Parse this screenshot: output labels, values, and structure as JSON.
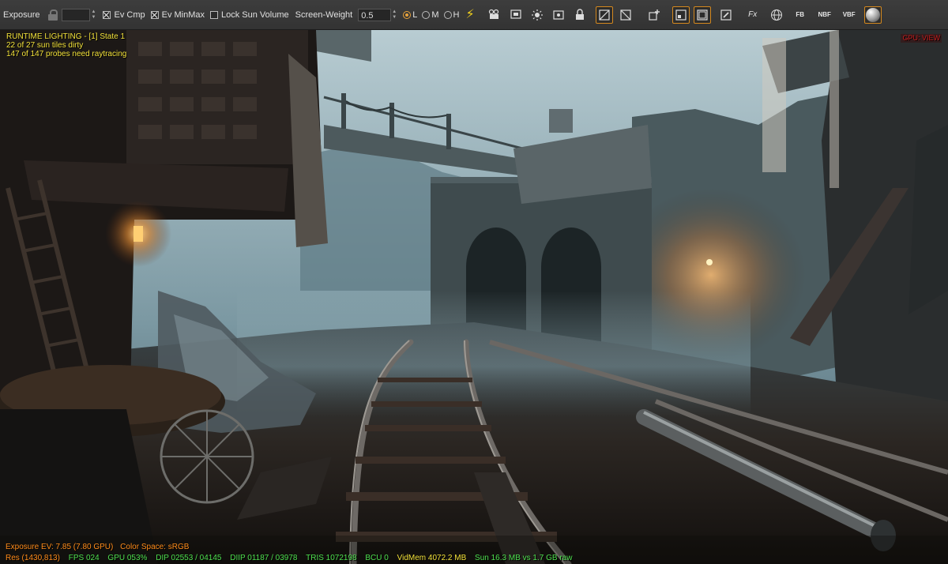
{
  "toolbar": {
    "exposure_label": "Exposure",
    "ev_cmp_label": "Ev Cmp",
    "ev_minmax_label": "Ev MinMax",
    "lock_sun_label": "Lock Sun Volume",
    "screen_weight_label": "Screen-Weight",
    "screen_weight_value": "0.5",
    "quality_low": "L",
    "quality_mid": "M",
    "quality_high": "H",
    "fb_label": "FB",
    "nbf_label": "NBF",
    "vbf_label": "VBF",
    "fx_label": "Fx",
    "accent_color": "#d4881e"
  },
  "overlay": {
    "lighting_title": "RUNTIME LIGHTING - [1] State 1",
    "sun_tiles": "22 of 27 sun tiles dirty",
    "probes": "147 of 147 probes need raytracing",
    "top_right": "GPU: VIEW",
    "exposure": "Exposure EV: 7.85 (7.80 GPU)",
    "color_space": "Color Space: sRGB"
  },
  "stats": {
    "res": "Res (1430,813)",
    "fps": "FPS 024",
    "gpu": "GPU 053%",
    "dip": "DIP 02553 / 04145",
    "diip": "DIIP 01187 / 03978",
    "tris": "TRIS 1072198",
    "bcu": "BCU 0",
    "vidmem": "VidMem 4072.2 MB",
    "sun": "Sun 16.3 MB vs 1.7 GB raw"
  }
}
